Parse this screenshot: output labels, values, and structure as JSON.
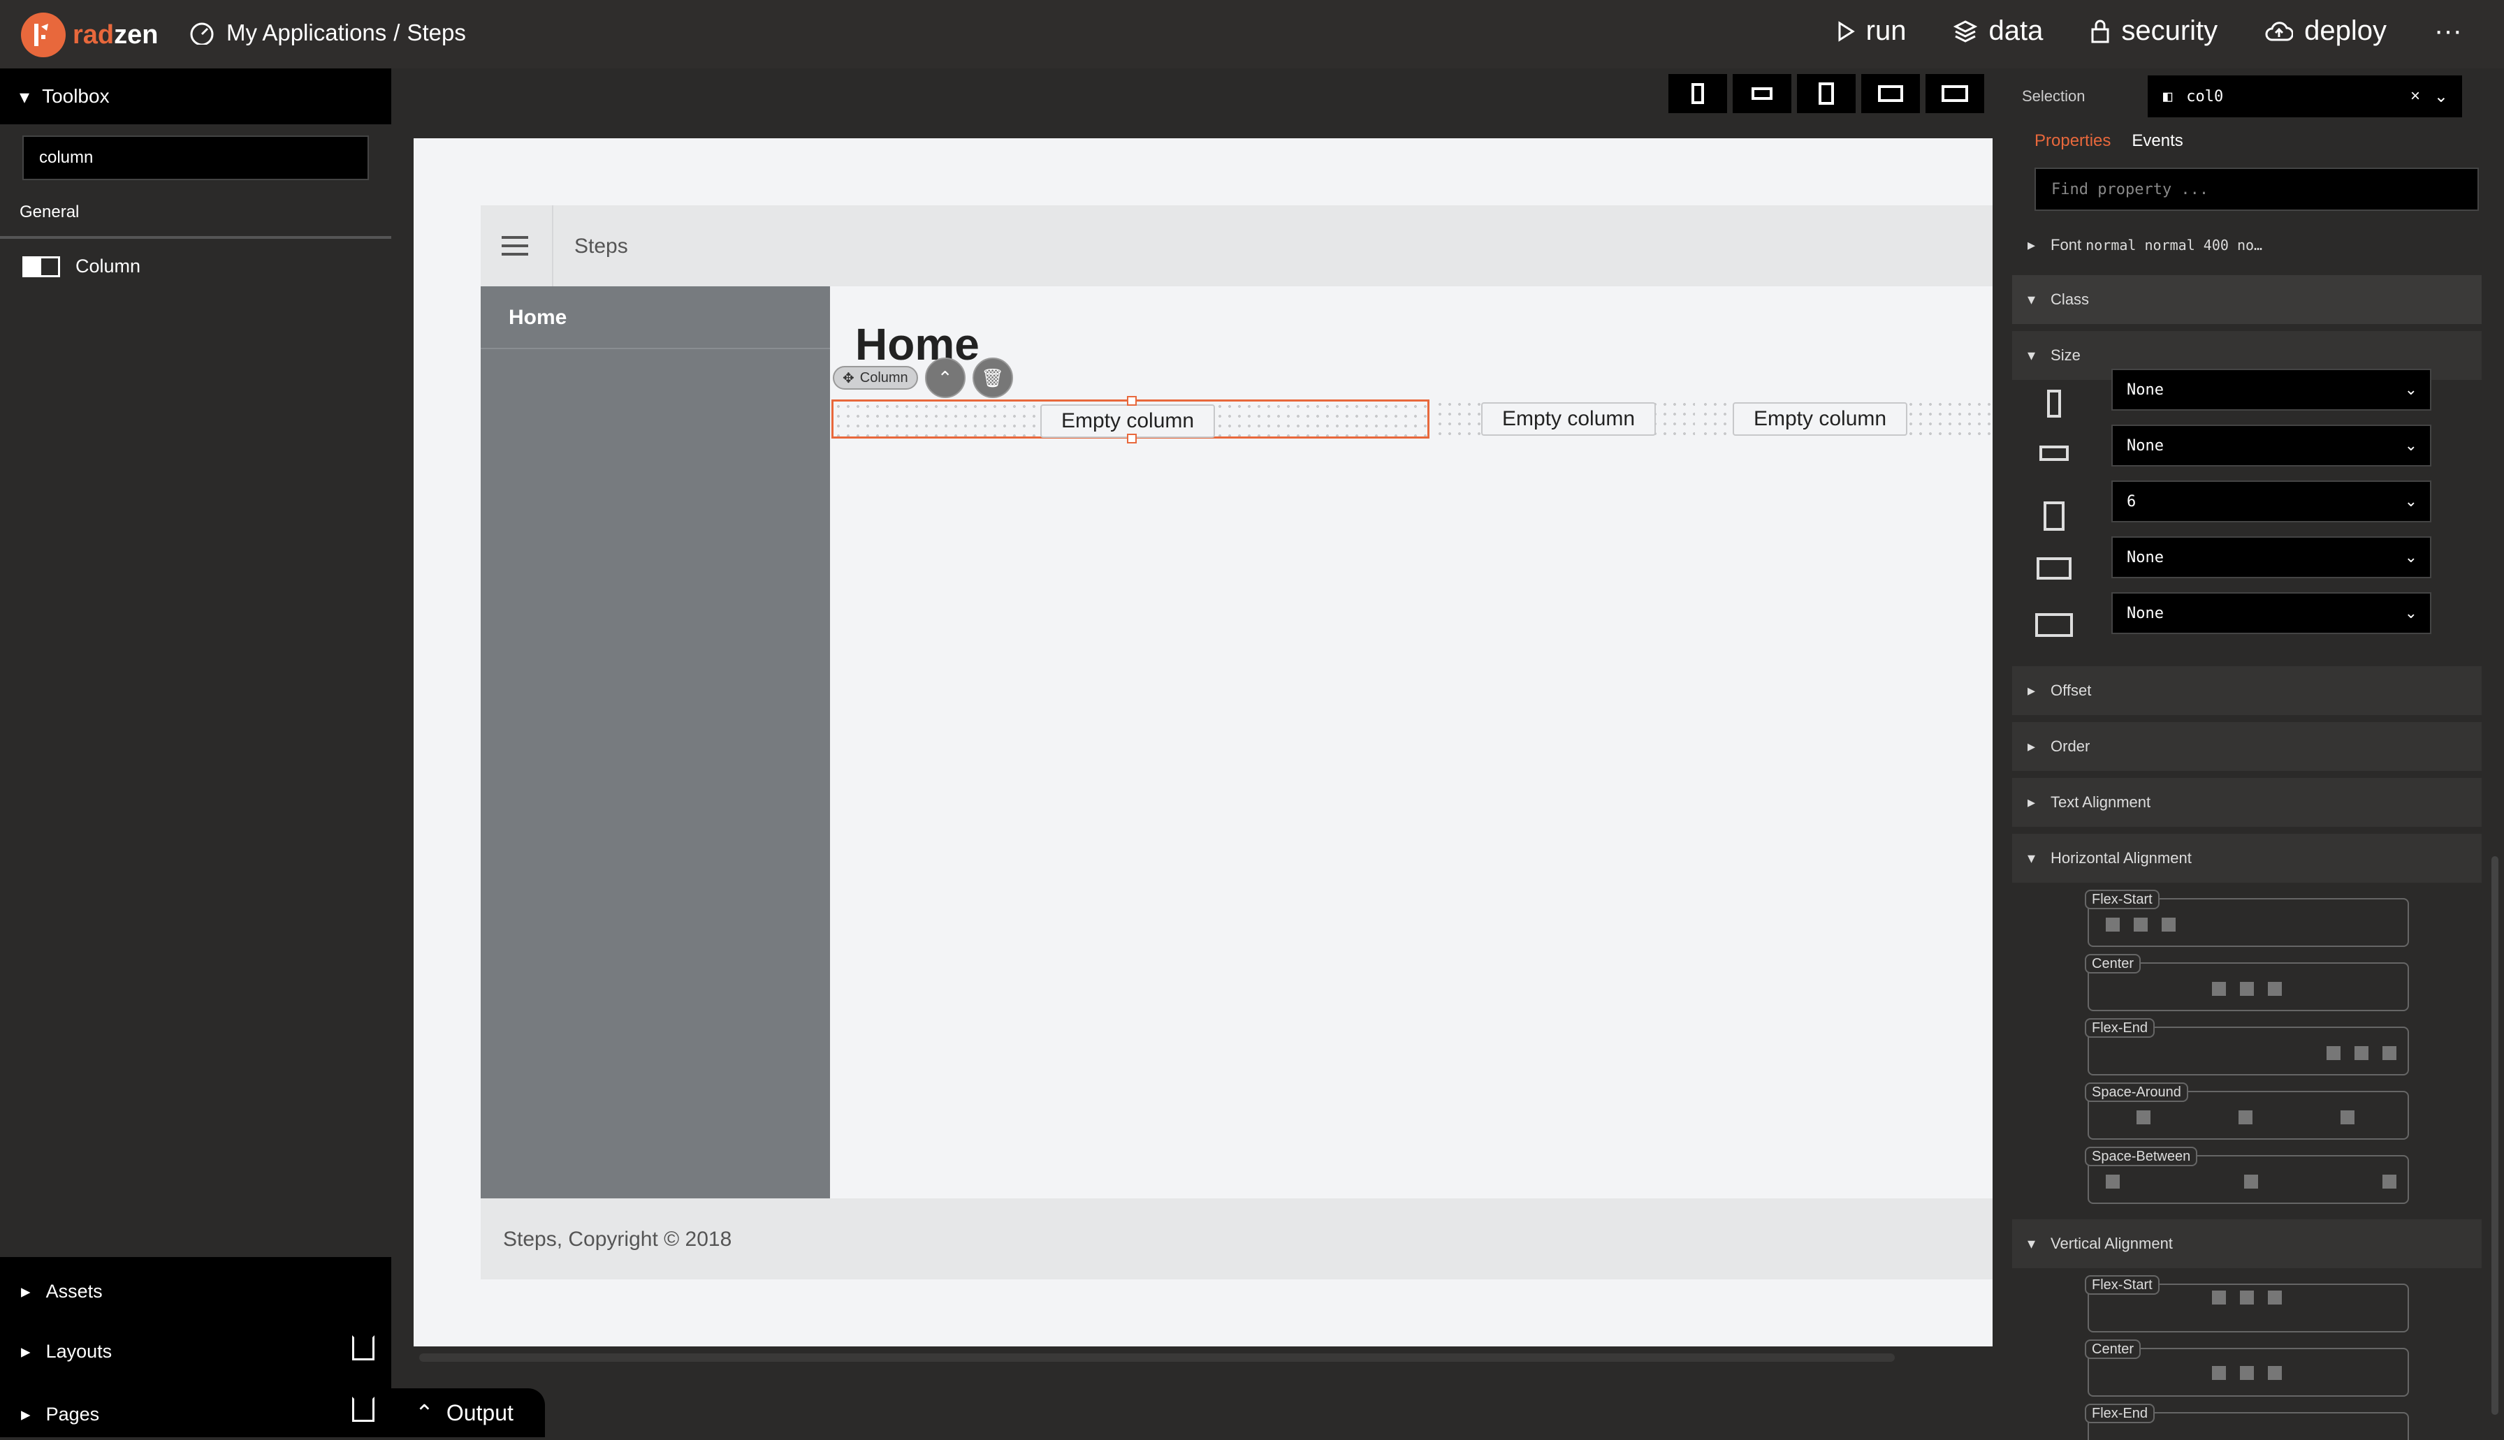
{
  "app": {
    "logo_text_a": "rad",
    "logo_text_b": "zen",
    "breadcrumb_root": "My Applications",
    "breadcrumb_sep": "/",
    "breadcrumb_page": "Steps"
  },
  "topnav": {
    "run": "run",
    "data": "data",
    "security": "security",
    "deploy": "deploy",
    "more": "···"
  },
  "toolbox": {
    "title": "Toolbox",
    "search_value": "column",
    "group": "General",
    "item": "Column"
  },
  "left_bottom": {
    "assets": "Assets",
    "layouts": "Layouts",
    "pages": "Pages"
  },
  "canvas": {
    "app_title": "Steps",
    "side_home": "Home",
    "heading": "Home",
    "column_tag": "Column",
    "empty_columns": [
      "Empty column",
      "Empty column",
      "Empty column"
    ],
    "footer": "Steps, Copyright © 2018"
  },
  "output": {
    "label": "Output"
  },
  "props": {
    "selection_label": "Selection",
    "selection_value": "col0",
    "tab_properties": "Properties",
    "tab_events": "Events",
    "find_placeholder": "Find property ...",
    "font_label": "Font",
    "font_value": "normal normal 400 no…",
    "class": "Class",
    "size": "Size",
    "size_values": [
      "None",
      "None",
      "6",
      "None",
      "None"
    ],
    "offset": "Offset",
    "order": "Order",
    "text_alignment": "Text Alignment",
    "horizontal_alignment": "Horizontal Alignment",
    "h_options": [
      "Flex-Start",
      "Center",
      "Flex-End",
      "Space-Around",
      "Space-Between"
    ],
    "vertical_alignment": "Vertical Alignment",
    "v_options": [
      "Flex-Start",
      "Center",
      "Flex-End"
    ]
  },
  "colors": {
    "accent": "#e8683c",
    "background": "#2b2a29",
    "sidebar": "#777b7f"
  }
}
